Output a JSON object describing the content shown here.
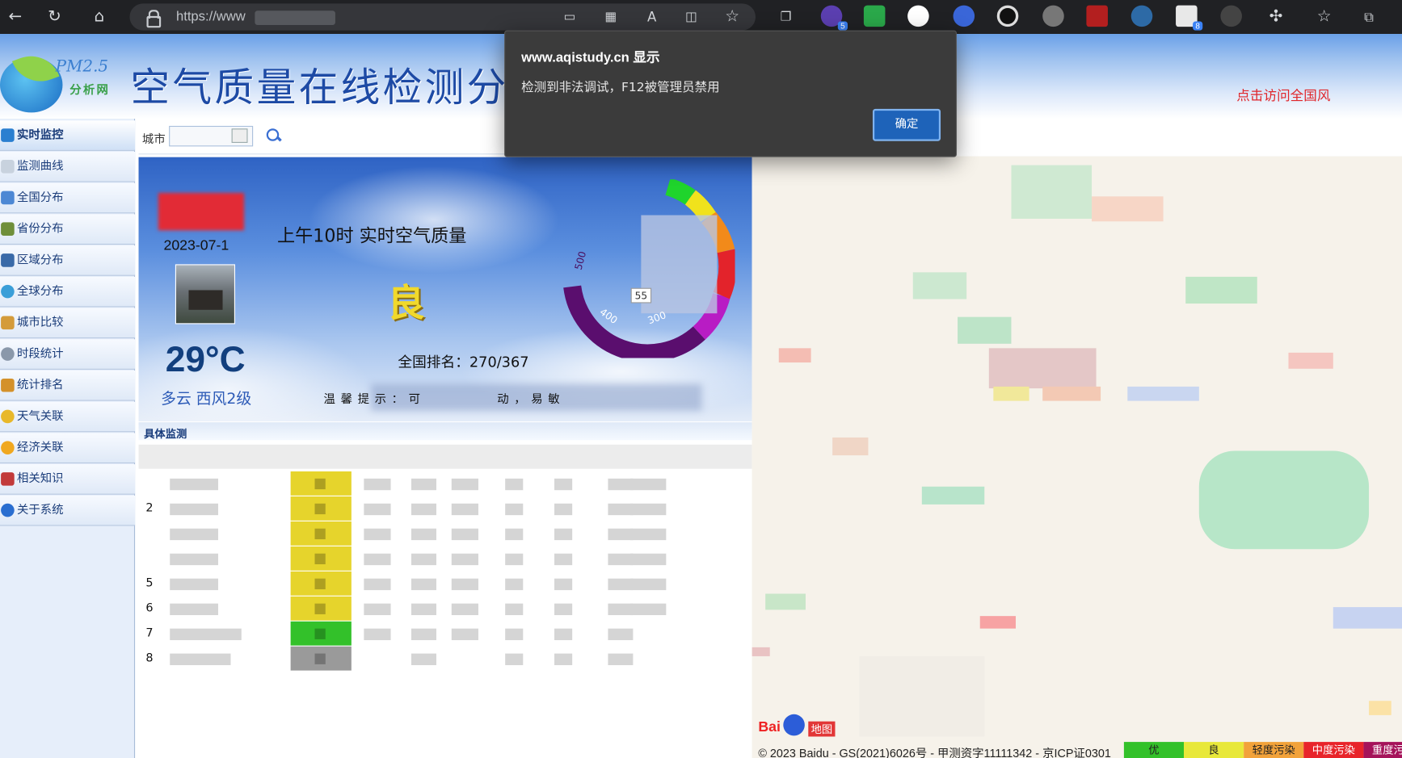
{
  "browser": {
    "url": "https://www",
    "extension_badges": [
      "5",
      "8"
    ]
  },
  "header": {
    "logo_top": "PM2.5",
    "logo_sub": "分析网",
    "title": "空气质量在线检测分",
    "right_note": "点击访问全国风"
  },
  "sidebar": {
    "items": [
      {
        "label": "实时监控",
        "icon": "monitor-icon",
        "active": true
      },
      {
        "label": "监测曲线",
        "icon": "curve-chart-icon"
      },
      {
        "label": "全国分布",
        "icon": "national-map-icon"
      },
      {
        "label": "省份分布",
        "icon": "province-map-icon"
      },
      {
        "label": "区域分布",
        "icon": "region-map-icon"
      },
      {
        "label": "全球分布",
        "icon": "globe-icon"
      },
      {
        "label": "城市比较",
        "icon": "city-compare-icon"
      },
      {
        "label": "时段统计",
        "icon": "clock-icon"
      },
      {
        "label": "统计排名",
        "icon": "ranking-icon"
      },
      {
        "label": "天气关联",
        "icon": "weather-icon"
      },
      {
        "label": "经济关联",
        "icon": "coin-icon"
      },
      {
        "label": "相关知识",
        "icon": "book-icon"
      },
      {
        "label": "关于系统",
        "icon": "info-icon"
      }
    ]
  },
  "search": {
    "label": "城市",
    "value": ""
  },
  "panel": {
    "date": "2023-07-1",
    "title": "上午10时 实时空气质量",
    "grade": "良",
    "temperature": "29°C",
    "weather": "多云 西风2级",
    "rank": "全国排名：270/367",
    "tip": "温馨提示：可",
    "tip_tail": "动，易敏",
    "gauge_value": "55",
    "gauge_ticks": [
      "500",
      "400",
      "300"
    ]
  },
  "section": {
    "title": "具体监测"
  },
  "table": {
    "rows": [
      {
        "num": "",
        "aqi_color": "#e6d42c"
      },
      {
        "num": "2",
        "aqi_color": "#e6d42c"
      },
      {
        "num": "",
        "aqi_color": "#e6d42c"
      },
      {
        "num": "",
        "aqi_color": "#e6d42c"
      },
      {
        "num": "5",
        "aqi_color": "#e6d42c"
      },
      {
        "num": "6",
        "aqi_color": "#e6d42c"
      },
      {
        "num": "7",
        "aqi_color": "#33c12a"
      },
      {
        "num": "8",
        "aqi_color": "#9a9a9a"
      }
    ]
  },
  "map": {
    "copyright": "© 2023 Baidu - GS(2021)6026号 - 甲测资字11111342 - 京ICP证0301",
    "brand_text": "Bai",
    "brand_badge": "地图",
    "legend": [
      {
        "label": "优",
        "color": "#33c12a"
      },
      {
        "label": "良",
        "color": "#e8e83a"
      },
      {
        "label": "轻度污染",
        "color": "#f2a23a"
      },
      {
        "label": "中度污染",
        "color": "#e8242a"
      },
      {
        "label": "重度污染",
        "color": "#a5135a"
      }
    ]
  },
  "dialog": {
    "title": "www.aqistudy.cn 显示",
    "message": "检测到非法调试，F12被管理员禁用",
    "ok_label": "确定"
  }
}
